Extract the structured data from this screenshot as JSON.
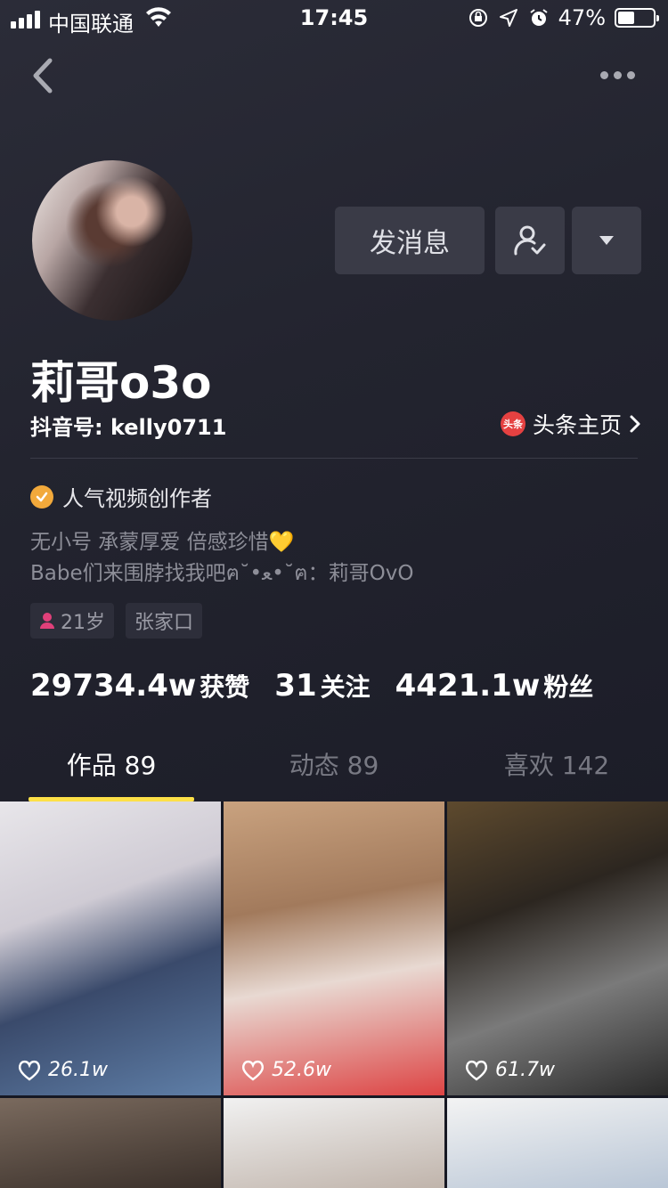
{
  "status_bar": {
    "carrier": "中国联通",
    "time": "17:45",
    "battery": "47%",
    "battery_level": 0.47
  },
  "profile": {
    "nickname": "莉哥o3o",
    "douyin_id": "抖音号: kelly0711",
    "toutiao_link": "头条主页",
    "toutiao_logo": "头条",
    "verification": "人气视频创作者",
    "bio_lines": [
      "无小号 承蒙厚爱 倍感珍惜💛",
      "Babe们来围脖找我吧ฅ˘•ﻌ•˘ฅ：莉哥OvO"
    ],
    "tags": {
      "age": "21岁",
      "city": "张家口"
    }
  },
  "actions": {
    "message_label": "发消息",
    "follow_icon": "user-check-icon",
    "dropdown_icon": "triangle-down-icon"
  },
  "stats": [
    {
      "value": "29734.4w",
      "label": "获赞"
    },
    {
      "value": "31",
      "label": "关注"
    },
    {
      "value": "4421.1w",
      "label": "粉丝"
    }
  ],
  "tabs": [
    {
      "label": "作品 89",
      "active": true
    },
    {
      "label": "动态 89",
      "active": false
    },
    {
      "label": "喜欢 142",
      "active": false
    }
  ],
  "videos": [
    {
      "likes": "26.1w"
    },
    {
      "likes": "52.6w"
    },
    {
      "likes": "61.7w"
    }
  ],
  "colors": {
    "background": "#161823",
    "accent_yellow": "#fde047",
    "button": "#3a3b47",
    "badge": "#f2a93b"
  }
}
